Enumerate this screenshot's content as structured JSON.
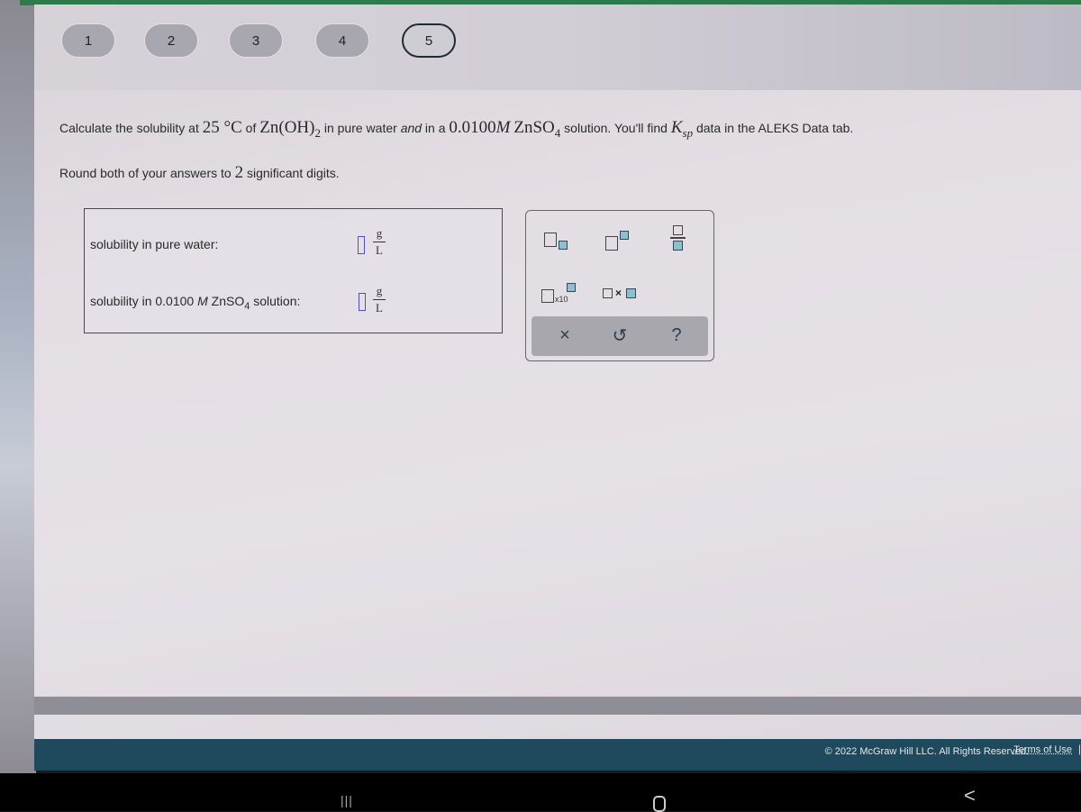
{
  "stepper": {
    "steps": [
      "1",
      "2",
      "3",
      "4",
      "5"
    ],
    "active_step": "5"
  },
  "question": {
    "part1": "Calculate the solubility at ",
    "temp": "25 °C",
    "part2": " of ",
    "compound": "Zn(OH)",
    "compound_sub": "2",
    "part3": " in pure water ",
    "and": "and",
    "part4": " in a ",
    "conc": "0.0100",
    "conc_unit": "M",
    "salt": "ZnSO",
    "salt_sub": "4",
    "part5": " solution. You'll find ",
    "ksp_K": "K",
    "ksp_sub": "sp",
    "part6": " data in the ALEKS Data tab."
  },
  "instruction": {
    "text": "Round both of your answers to ",
    "digits": "2",
    "suffix": " significant digits."
  },
  "answers": [
    {
      "label": "solubility in pure water:",
      "value": "",
      "unit_numerator": "g",
      "unit_denominator": "L"
    },
    {
      "label_prefix": "solubility in 0.0100 ",
      "label_unit": "M",
      "label_salt": " ZnSO",
      "label_salt_sub": "4",
      "label_suffix": " solution:",
      "value": "",
      "unit_numerator": "g",
      "unit_denominator": "L"
    }
  ],
  "toolbox": {
    "tools": [
      "subscript",
      "superscript",
      "fraction",
      "scientific-notation",
      "multiply"
    ],
    "x10_label": "x10",
    "times_label": "×",
    "actions": {
      "clear": "×",
      "undo": "↺",
      "help": "?"
    }
  },
  "footer": {
    "copyright": "© 2022 McGraw Hill LLC. All Rights Reserved.",
    "terms": "Terms of Use",
    "separator": "|"
  },
  "android_nav": {
    "recents": "|||",
    "back": "<"
  },
  "colors": {
    "footer_bg": "#1f4a5d",
    "input_border": "#4b4fd0",
    "tool_blue": "#8fbfcf",
    "top_bar_green": "#2f7a4c"
  }
}
